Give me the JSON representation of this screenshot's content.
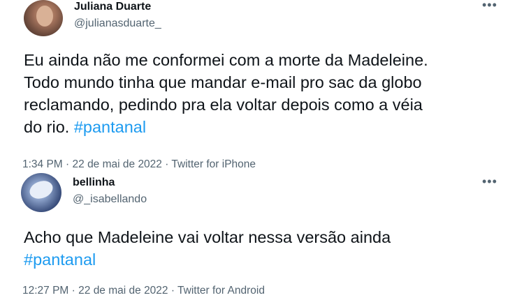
{
  "tweets": [
    {
      "display_name": "Juliana Duarte",
      "handle": "@julianasduarte_",
      "more_icon": "more-dots-icon",
      "body_lines": [
        "Eu ainda não me conformei com a morte da Madeleine.",
        "Todo mundo tinha que mandar e-mail pro sac da globo",
        "reclamando, pedindo pra ela voltar depois como a véia",
        "do rio. "
      ],
      "hashtag": "#pantanal",
      "time": "1:34 PM",
      "date": "22 de mai de 2022",
      "source": "Twitter for iPhone",
      "separator": " · "
    },
    {
      "display_name": "bellinha",
      "handle": "@_isabellando",
      "more_icon": "more-dots-icon",
      "body_lines": [
        "Acho que Madeleine vai voltar nessa versão ainda"
      ],
      "hashtag": "#pantanal",
      "time": "12:27 PM",
      "date": "22 de mai de 2022",
      "source": "Twitter for Android",
      "separator": " · "
    }
  ],
  "colors": {
    "text": "#0f1419",
    "secondary": "#536471",
    "link": "#1d9bf0",
    "background": "#ffffff"
  }
}
